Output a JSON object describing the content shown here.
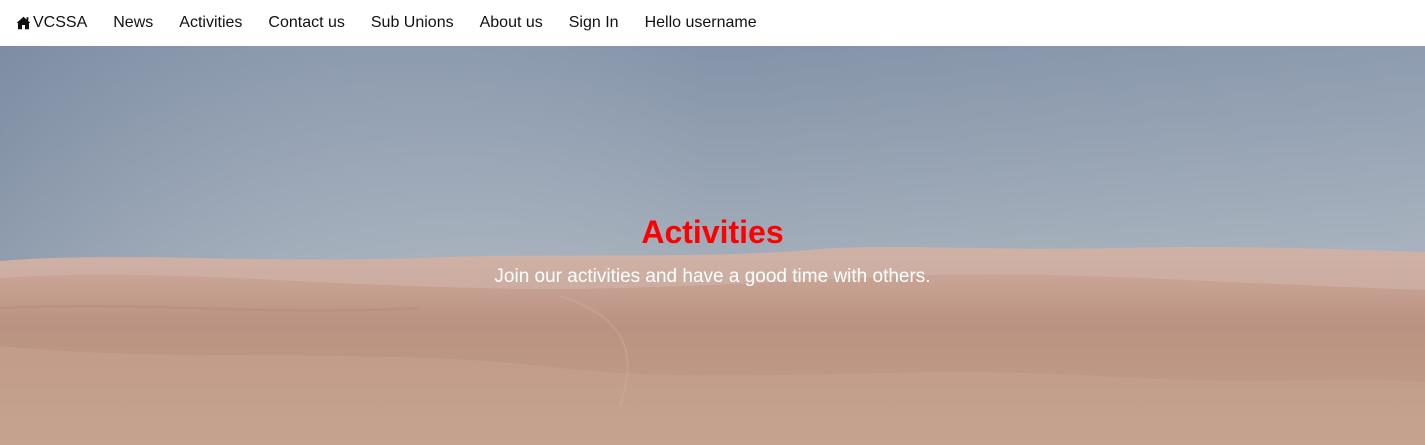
{
  "nav": {
    "brand_icon": "home-icon",
    "brand_label": "VCSSA",
    "links": [
      {
        "label": "News"
      },
      {
        "label": "Activities"
      },
      {
        "label": "Contact us"
      },
      {
        "label": "Sub Unions"
      },
      {
        "label": "About us"
      },
      {
        "label": "Sign In"
      },
      {
        "label": "Hello username"
      }
    ]
  },
  "hero": {
    "title": "Activities",
    "subtitle": "Join our activities and have a good time with others.",
    "title_color": "#ff0000",
    "background": "desert-dunes-under-sky"
  }
}
